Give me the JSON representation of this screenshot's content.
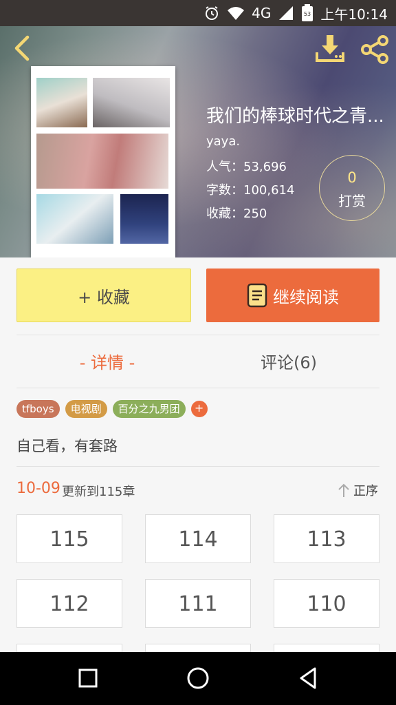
{
  "status_bar": {
    "network": "4G",
    "battery_level": "53",
    "time": "上午10:14"
  },
  "book": {
    "title": "我们的棒球时代之青...",
    "author": "yaya.",
    "stats": [
      {
        "label": "人气：",
        "value": "53,696"
      },
      {
        "label": "字数：",
        "value": "100,614"
      },
      {
        "label": "收藏：",
        "value": "250"
      }
    ],
    "tip": {
      "count": "0",
      "label": "打赏"
    }
  },
  "actions": {
    "favorite_label": "+ 收藏",
    "continue_label": "继续阅读"
  },
  "tabs": [
    {
      "label": "- 详情 -",
      "active": true
    },
    {
      "label": "评论(6)",
      "active": false
    }
  ],
  "tags": [
    {
      "label": "tfboys",
      "color": "#c8765a"
    },
    {
      "label": "电视剧",
      "color": "#d39b46"
    },
    {
      "label": "百分之九男团",
      "color": "#8cae5a"
    }
  ],
  "tag_add_label": "+",
  "description": "自己看，有套路",
  "update": {
    "date": "10-09",
    "text": "更新到115章",
    "order_label": "正序"
  },
  "chapters": [
    "115",
    "114",
    "113",
    "112",
    "111",
    "110"
  ],
  "colors": {
    "accent": "#ec6b3d",
    "favorite_bg": "#fbf084",
    "tip_count": "#ffe68a"
  },
  "icons": {
    "top_bar": [
      "back-arrow-icon",
      "download-icon",
      "share-icon"
    ],
    "status": [
      "alarm-icon",
      "wifi-icon",
      "signal-icon",
      "battery-icon"
    ],
    "nav": [
      "recent-apps-icon",
      "home-icon",
      "back-icon"
    ]
  }
}
